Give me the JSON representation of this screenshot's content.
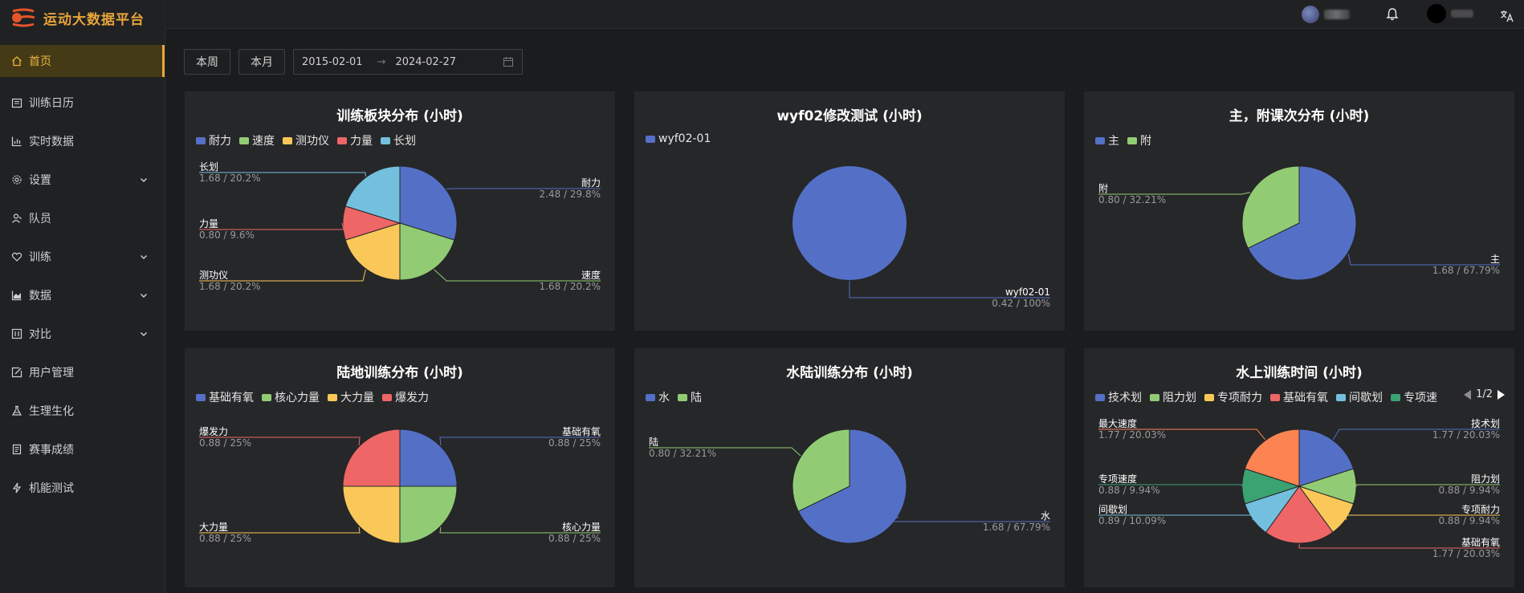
{
  "app": {
    "title": "运动大数据平台"
  },
  "sidebar": {
    "items": [
      {
        "label": "首页",
        "icon": "home-icon",
        "active": true,
        "expandable": false
      },
      {
        "label": "训练日历",
        "icon": "calendar-icon",
        "expandable": false
      },
      {
        "label": "实时数据",
        "icon": "bar-chart-icon",
        "expandable": false
      },
      {
        "label": "设置",
        "icon": "gear-icon",
        "expandable": true
      },
      {
        "label": "队员",
        "icon": "user-icon",
        "expandable": false
      },
      {
        "label": "训练",
        "icon": "heart-icon",
        "expandable": true
      },
      {
        "label": "数据",
        "icon": "area-chart-icon",
        "expandable": true
      },
      {
        "label": "对比",
        "icon": "compare-icon",
        "expandable": true
      },
      {
        "label": "用户管理",
        "icon": "edit-icon",
        "expandable": false
      },
      {
        "label": "生理生化",
        "icon": "flask-icon",
        "expandable": false
      },
      {
        "label": "赛事成绩",
        "icon": "document-icon",
        "expandable": false
      },
      {
        "label": "机能测试",
        "icon": "thunder-icon",
        "expandable": false
      }
    ]
  },
  "filters": {
    "week_label": "本周",
    "month_label": "本月",
    "start_date": "2015-02-01",
    "end_date": "2024-02-27",
    "separator": "→"
  },
  "colors": {
    "blue": "#5470c6",
    "green": "#91cc75",
    "yellow": "#fac858",
    "red": "#ee6666",
    "cyan": "#73c0de",
    "teal": "#3ba272",
    "orange": "#fc8452"
  },
  "chart_data": [
    {
      "type": "pie",
      "title": "训练板块分布 (小时)",
      "legend": [
        "耐力",
        "速度",
        "测功仪",
        "力量",
        "长划"
      ],
      "slices": [
        {
          "name": "耐力",
          "value": 2.48,
          "percent": "29.8%",
          "color": "#5470c6",
          "label": "2.48 / 29.8%"
        },
        {
          "name": "速度",
          "value": 1.68,
          "percent": "20.2%",
          "color": "#91cc75",
          "label": "1.68 / 20.2%"
        },
        {
          "name": "测功仪",
          "value": 1.68,
          "percent": "20.2%",
          "color": "#fac858",
          "label": "1.68 / 20.2%"
        },
        {
          "name": "力量",
          "value": 0.8,
          "percent": "9.6%",
          "color": "#ee6666",
          "label": "0.80 / 9.6%"
        },
        {
          "name": "长划",
          "value": 1.68,
          "percent": "20.2%",
          "color": "#73c0de",
          "label": "1.68 / 20.2%"
        }
      ]
    },
    {
      "type": "pie",
      "title": "wyf02修改测试 (小时)",
      "legend": [
        "wyf02-01"
      ],
      "slices": [
        {
          "name": "wyf02-01",
          "value": 0.42,
          "percent": "100%",
          "color": "#5470c6",
          "label": "0.42 / 100%"
        }
      ]
    },
    {
      "type": "pie",
      "title": "主，附课次分布 (小时)",
      "legend": [
        "主",
        "附"
      ],
      "slices": [
        {
          "name": "主",
          "value": 1.68,
          "percent": "67.79%",
          "color": "#5470c6",
          "label": "1.68 / 67.79%"
        },
        {
          "name": "附",
          "value": 0.8,
          "percent": "32.21%",
          "color": "#91cc75",
          "label": "0.80 / 32.21%"
        }
      ]
    },
    {
      "type": "pie",
      "title": "陆地训练分布 (小时)",
      "legend": [
        "基础有氧",
        "核心力量",
        "大力量",
        "爆发力"
      ],
      "slices": [
        {
          "name": "基础有氧",
          "value": 0.88,
          "percent": "25%",
          "color": "#5470c6",
          "label": "0.88 / 25%"
        },
        {
          "name": "核心力量",
          "value": 0.88,
          "percent": "25%",
          "color": "#91cc75",
          "label": "0.88 / 25%"
        },
        {
          "name": "大力量",
          "value": 0.88,
          "percent": "25%",
          "color": "#fac858",
          "label": "0.88 / 25%"
        },
        {
          "name": "爆发力",
          "value": 0.88,
          "percent": "25%",
          "color": "#ee6666",
          "label": "0.88 / 25%"
        }
      ]
    },
    {
      "type": "pie",
      "title": "水陆训练分布 (小时)",
      "legend": [
        "水",
        "陆"
      ],
      "slices": [
        {
          "name": "水",
          "value": 1.68,
          "percent": "67.79%",
          "color": "#5470c6",
          "label": "1.68 / 67.79%"
        },
        {
          "name": "陆",
          "value": 0.8,
          "percent": "32.21%",
          "color": "#91cc75",
          "label": "0.80 / 32.21%"
        }
      ]
    },
    {
      "type": "pie",
      "title": "水上训练时间 (小时)",
      "legend": [
        "技术划",
        "阻力划",
        "专项耐力",
        "基础有氧",
        "间歇划",
        "专项速度"
      ],
      "legend_page": "1/2",
      "slices": [
        {
          "name": "技术划",
          "value": 1.77,
          "percent": "20.03%",
          "color": "#5470c6",
          "label": "1.77 / 20.03%"
        },
        {
          "name": "阻力划",
          "value": 0.88,
          "percent": "9.94%",
          "color": "#91cc75",
          "label": "0.88 / 9.94%"
        },
        {
          "name": "专项耐力",
          "value": 0.88,
          "percent": "9.94%",
          "color": "#fac858",
          "label": "0.88 / 9.94%"
        },
        {
          "name": "基础有氧",
          "value": 1.77,
          "percent": "20.03%",
          "color": "#ee6666",
          "label": "1.77 / 20.03%"
        },
        {
          "name": "间歇划",
          "value": 0.89,
          "percent": "10.09%",
          "color": "#73c0de",
          "label": "0.89 / 10.09%"
        },
        {
          "name": "专项速度",
          "value": 0.88,
          "percent": "9.94%",
          "color": "#3ba272",
          "label": "0.88 / 9.94%"
        },
        {
          "name": "最大速度",
          "value": 1.77,
          "percent": "20.03%",
          "color": "#fc8452",
          "label": "1.77 / 20.03%"
        }
      ]
    }
  ]
}
